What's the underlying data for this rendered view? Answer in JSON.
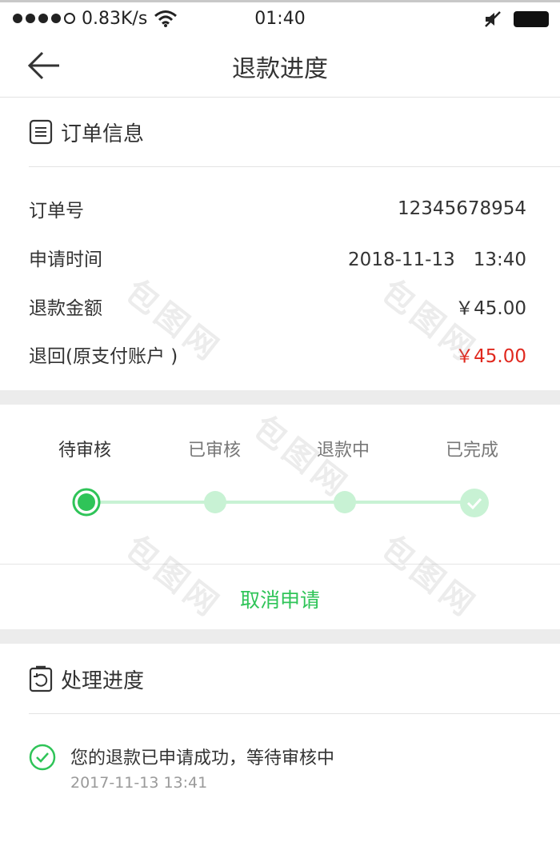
{
  "status_bar": {
    "network_speed": "0.83K/s",
    "time": "01:40"
  },
  "nav": {
    "title": "退款进度"
  },
  "order_info": {
    "title": "订单信息",
    "rows": [
      {
        "label": "订单号",
        "value": "12345678954"
      },
      {
        "label": "申请时间",
        "value": "2018-11-13　13:40"
      },
      {
        "label": "退款金额",
        "value": "￥45.00"
      },
      {
        "label": "退回(原支付账户 )",
        "value": "￥45.00"
      }
    ]
  },
  "steps": {
    "current_index": 0,
    "items": [
      {
        "label": "待审核"
      },
      {
        "label": "已审核"
      },
      {
        "label": "退款中"
      },
      {
        "label": "已完成"
      }
    ]
  },
  "cancel_label": "取消申请",
  "progress": {
    "title": "处理进度",
    "entry": {
      "text": "您的退款已申请成功，等待审核中",
      "time": "2017-11-13 13:41"
    }
  },
  "watermark": "包图网",
  "colors": {
    "accent_green": "#2fc458",
    "light_green": "#c8f2d4",
    "refund_red": "#e0281e",
    "gap_gray": "#ececec"
  }
}
